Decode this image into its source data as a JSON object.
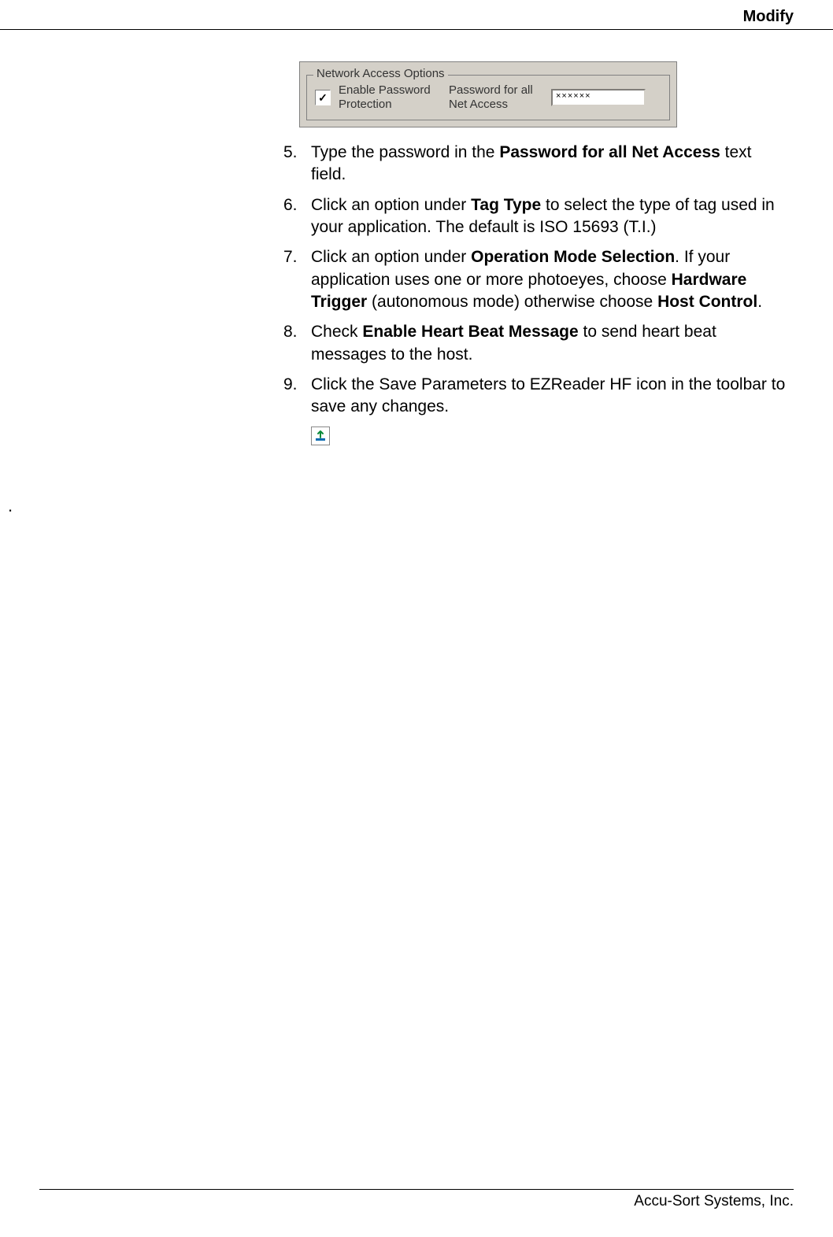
{
  "header": {
    "title": "Modify"
  },
  "dialog": {
    "legend": "Network Access Options",
    "checkbox_checked": true,
    "checkbox_mark": "✓",
    "label_enable": "Enable Password Protection",
    "label_password": "Password for all Net Access",
    "password_value": "××××××"
  },
  "steps": [
    {
      "num": "5.",
      "prefix": "Type the password in the ",
      "bold1": "Password for all Net Access",
      "suffix": " text field."
    },
    {
      "num": "6.",
      "prefix": "Click an option under ",
      "bold1": "Tag Type",
      "suffix": " to select the type of tag used in your application. The default is ISO 15693 (T.I.)"
    },
    {
      "num": "7.",
      "prefix": "Click an option under ",
      "bold1": "Operation Mode Selection",
      "mid1": ". If your application uses one or more photoeyes, choose ",
      "bold2": "Hardware Trigger",
      "mid2": " (autonomous mode) otherwise choose ",
      "bold3": "Host Control",
      "suffix": "."
    },
    {
      "num": "8.",
      "prefix": "Check ",
      "bold1": "Enable Heart Beat Message",
      "suffix": " to send heart beat messages to the host."
    },
    {
      "num": "9.",
      "prefix": "Click the Save Parameters to EZReader HF icon in the toolbar to save any changes.",
      "suffix": ""
    }
  ],
  "stray": ".",
  "footer": {
    "text": "Accu-Sort Systems, Inc."
  }
}
